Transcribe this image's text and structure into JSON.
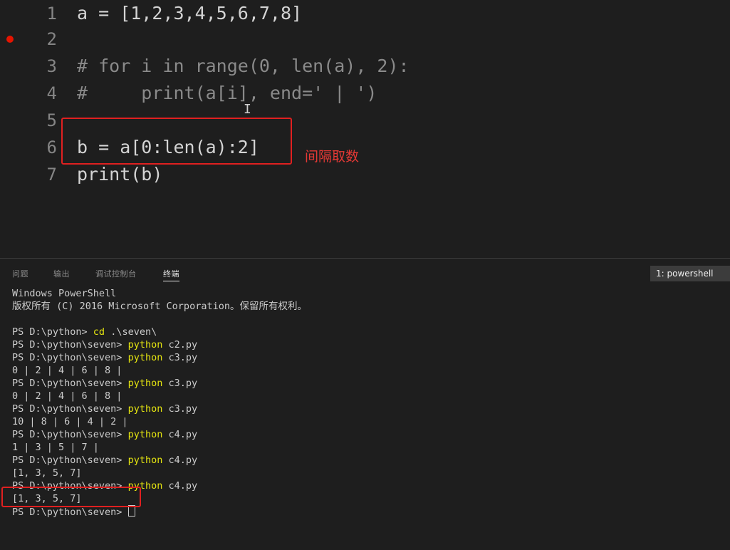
{
  "editor": {
    "lines": [
      {
        "num": "1",
        "text": "a = [1,2,3,4,5,6,7,8]"
      },
      {
        "num": "2",
        "text": ""
      },
      {
        "num": "3",
        "text": "# for i in range(0, len(a), 2):"
      },
      {
        "num": "4",
        "text": "#     print(a[i], end=' | ')"
      },
      {
        "num": "5",
        "text": ""
      },
      {
        "num": "6",
        "text": "b = a[0:len(a):2]"
      },
      {
        "num": "7",
        "text": "print(b)"
      }
    ],
    "annotation": "间隔取数"
  },
  "panel": {
    "tabs": [
      "问题",
      "输出",
      "调试控制台",
      "终端"
    ],
    "active_tab": "终端",
    "terminal_selector": "1: powershell"
  },
  "terminal": {
    "header1": "Windows PowerShell",
    "header2": "版权所有 (C) 2016 Microsoft Corporation。保留所有权利。",
    "entries": [
      {
        "prompt": "PS D:\\python> ",
        "cmd": "cd",
        "args": " .\\seven\\"
      },
      {
        "prompt": "PS D:\\python\\seven> ",
        "cmd": "python",
        "args": " c2.py"
      },
      {
        "prompt": "PS D:\\python\\seven> ",
        "cmd": "python",
        "args": " c3.py"
      },
      {
        "output": "0 | 2 | 4 | 6 | 8 |"
      },
      {
        "prompt": "PS D:\\python\\seven> ",
        "cmd": "python",
        "args": " c3.py"
      },
      {
        "output": "0 | 2 | 4 | 6 | 8 |"
      },
      {
        "prompt": "PS D:\\python\\seven> ",
        "cmd": "python",
        "args": " c3.py"
      },
      {
        "output": "10 | 8 | 6 | 4 | 2 |"
      },
      {
        "prompt": "PS D:\\python\\seven> ",
        "cmd": "python",
        "args": " c4.py"
      },
      {
        "output": "1 | 3 | 5 | 7 |"
      },
      {
        "prompt": "PS D:\\python\\seven> ",
        "cmd": "python",
        "args": " c4.py"
      },
      {
        "output": "[1, 3, 5, 7]"
      },
      {
        "prompt": "PS D:\\python\\seven> ",
        "cmd": "python",
        "args": " c4.py"
      },
      {
        "output": "[1, 3, 5, 7]"
      }
    ],
    "final_prompt": "PS D:\\python\\seven> "
  },
  "colors": {
    "accent_box": "#e02020",
    "command": "#e5e510",
    "breakpoint": "#e51400"
  }
}
